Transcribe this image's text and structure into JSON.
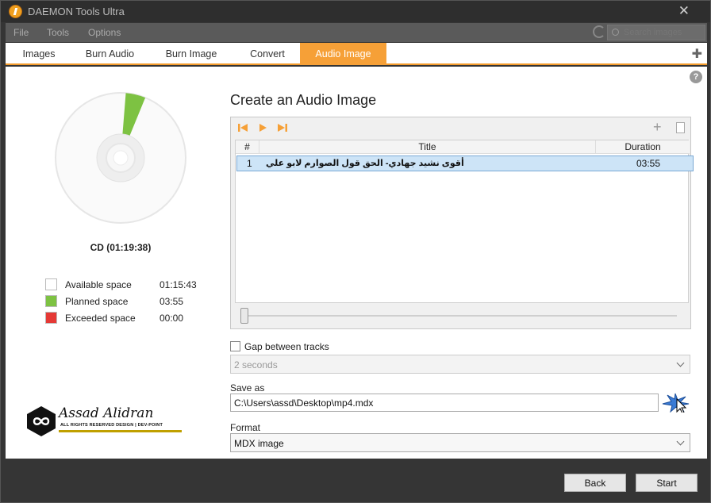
{
  "app": {
    "title": "DAEMON Tools Ultra"
  },
  "menu": [
    "File",
    "Tools",
    "Options"
  ],
  "search": {
    "placeholder": "Search images"
  },
  "tabs": [
    "Images",
    "Burn Audio",
    "Burn Image",
    "Convert",
    "Audio Image"
  ],
  "active_tab": "Audio Image",
  "disc": {
    "label": "CD (01:19:38)",
    "total_seconds": 4778,
    "planned_seconds": 235,
    "legend": [
      {
        "label": "Available space",
        "value": "01:15:43",
        "color": "#ffffff"
      },
      {
        "label": "Planned space",
        "value": "03:55",
        "color": "#7dc242"
      },
      {
        "label": "Exceeded space",
        "value": "00:00",
        "color": "#e53935"
      }
    ]
  },
  "watermark": {
    "name": "Assad Alidran",
    "rights": "ALL RIGHTS RESERVED DESIGN | DEV-POINT"
  },
  "main": {
    "title": "Create an Audio Image",
    "table": {
      "columns": [
        "#",
        "Title",
        "Duration"
      ],
      "rows": [
        {
          "num": "1",
          "title": "أقوى نشيد جهادي- الحق قول الصوارم لابو علي",
          "duration": "03:55"
        }
      ]
    },
    "gap": {
      "label": "Gap between tracks",
      "value": "2 seconds"
    },
    "save_as": {
      "label": "Save as",
      "value": "C:\\Users\\assd\\Desktop\\mp4.mdx"
    },
    "format": {
      "label": "Format",
      "value": "MDX image"
    }
  },
  "footer": {
    "back": "Back",
    "start": "Start"
  },
  "colors": {
    "accent": "#f6a037",
    "planned": "#7dc242",
    "exceeded": "#e53935"
  }
}
